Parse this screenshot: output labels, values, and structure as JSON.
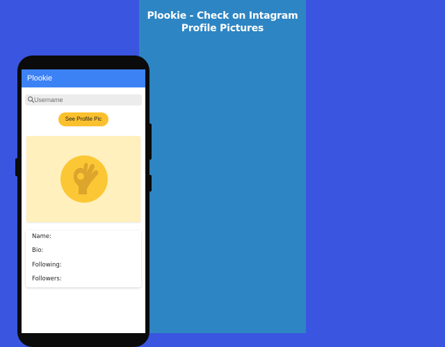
{
  "promo": {
    "title_line1": "Plookie - Check on Intagram",
    "title_line2": "Profile Pictures"
  },
  "app": {
    "title": "Plookie",
    "search": {
      "placeholder": "Username",
      "icon": "search-icon"
    },
    "see_button_label": "See Profile Pic",
    "profile_picture_icon": "ok-hand-icon",
    "info": {
      "name_label": "Name:",
      "bio_label": "Bio:",
      "following_label": "Following:",
      "followers_label": "Followers:"
    }
  },
  "colors": {
    "background": "#3a55e0",
    "panel": "#2e85c3",
    "app_bar": "#3d82f4",
    "button": "#fbc02d",
    "picture_card": "#fff0bd",
    "picture_circle": "#fbc735"
  }
}
